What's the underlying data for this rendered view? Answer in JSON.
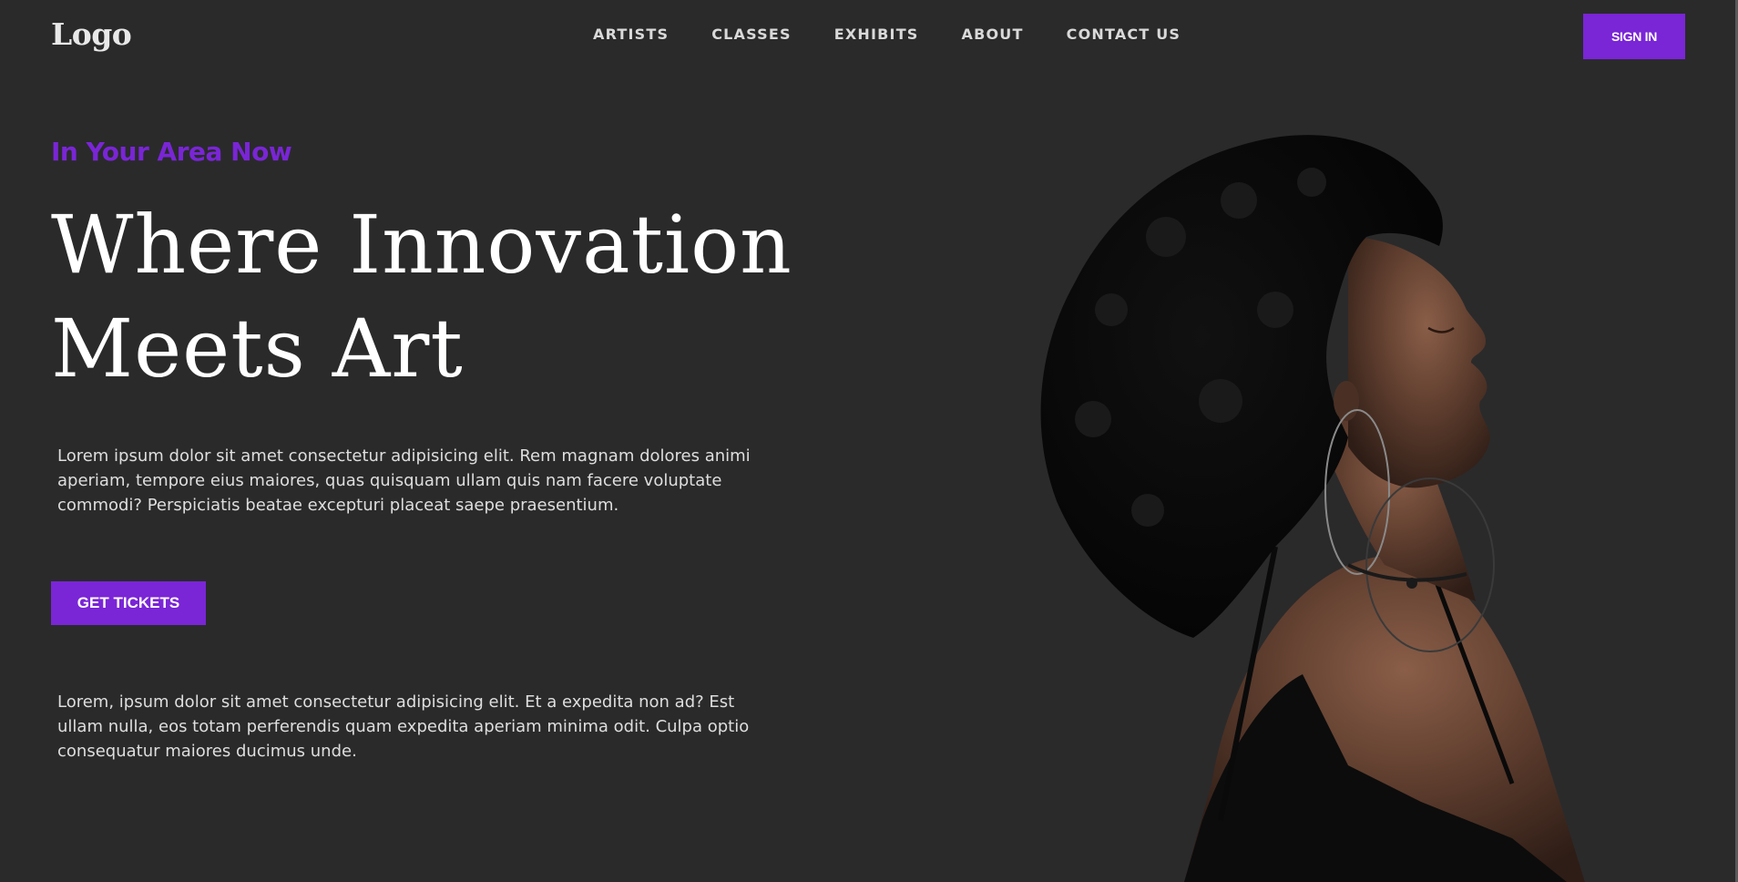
{
  "header": {
    "logo": "Logo",
    "nav": [
      {
        "label": "ARTISTS"
      },
      {
        "label": "CLASSES"
      },
      {
        "label": "EXHIBITS"
      },
      {
        "label": "ABOUT"
      },
      {
        "label": "CONTACT US"
      }
    ],
    "signin_label": "SIGN IN"
  },
  "hero": {
    "eyebrow": "In Your Area Now",
    "headline_line1": "Where Innovation",
    "headline_line2": "Meets Art",
    "paragraph1": "Lorem ipsum dolor sit amet consectetur adipisicing elit. Rem magnam dolores animi aperiam, tempore eius maiores, quas quisquam ullam quis nam facere voluptate commodi? Perspiciatis beatae excepturi placeat saepe praesentium.",
    "cta_label": "GET TICKETS",
    "paragraph2": "Lorem, ipsum dolor sit amet consectetur adipisicing elit. Et a expedita non ad? Est ullam nulla, eos totam perferendis quam expedita aperiam minima odit. Culpa optio consequatur maiores ducimus unde."
  },
  "colors": {
    "background": "#2a2a2b",
    "accent": "#7a25d6",
    "heading": "#ffffff",
    "body_text": "#dedede"
  }
}
